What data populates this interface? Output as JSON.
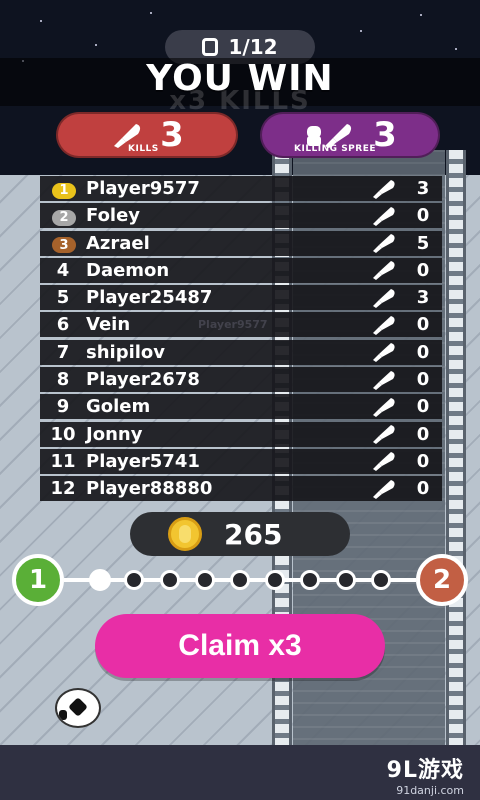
{
  "header": {
    "round_text": "1/12",
    "title": "YOU WIN",
    "ghost_banner": "x3 KILLS"
  },
  "stats": {
    "kills_value": "3",
    "kills_label": "KILLS",
    "spree_value": "3",
    "spree_label": "KILLING SPREE"
  },
  "leaderboard": [
    {
      "rank": "1",
      "name": "Player9577",
      "kills": "3",
      "medal_color": "#e9c21b"
    },
    {
      "rank": "2",
      "name": "Foley",
      "kills": "0",
      "medal_color": "#a7a7a7"
    },
    {
      "rank": "3",
      "name": "Azrael",
      "kills": "5",
      "medal_color": "#a6622b"
    },
    {
      "rank": "4",
      "name": "Daemon",
      "kills": "0"
    },
    {
      "rank": "5",
      "name": "Player25487",
      "kills": "3"
    },
    {
      "rank": "6",
      "name": "Vein",
      "kills": "0"
    },
    {
      "rank": "7",
      "name": "shipilov",
      "kills": "0"
    },
    {
      "rank": "8",
      "name": "Player2678",
      "kills": "0"
    },
    {
      "rank": "9",
      "name": "Golem",
      "kills": "0"
    },
    {
      "rank": "10",
      "name": "Jonny",
      "kills": "0"
    },
    {
      "rank": "11",
      "name": "Player5741",
      "kills": "0"
    },
    {
      "rank": "12",
      "name": "Player88880",
      "kills": "0"
    }
  ],
  "floating_player_name": "Player9577",
  "coins": {
    "amount": "265"
  },
  "progress": {
    "start_level": "1",
    "end_level": "2",
    "completed_steps": 1,
    "total_steps": 9
  },
  "claim_button": {
    "label": "Claim x3"
  },
  "watermark": {
    "main": "9L游戏",
    "sub": "91danji.com"
  },
  "colors": {
    "kills_pill": "#c0403f",
    "spree_pill": "#7d2e89",
    "claim": "#e82ea6",
    "start_node": "#5aaf37",
    "end_node": "#c25f44"
  }
}
